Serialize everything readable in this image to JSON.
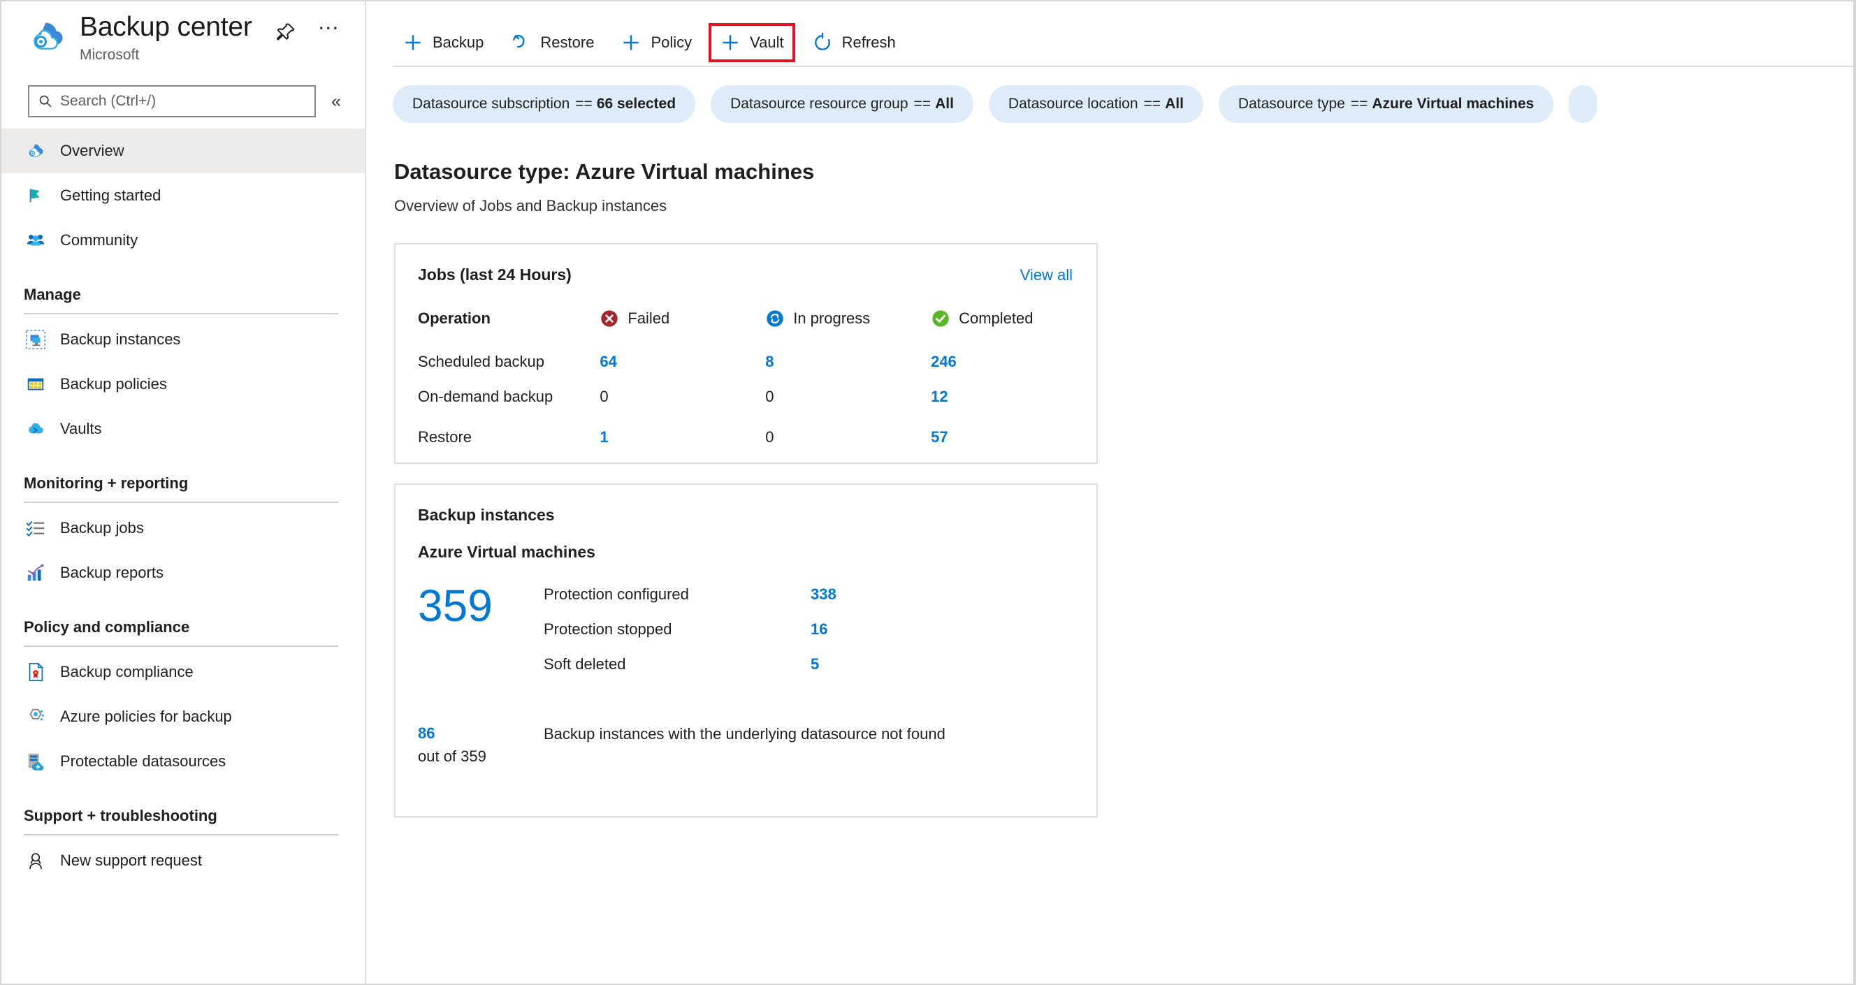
{
  "header": {
    "title": "Backup center",
    "subtitle": "Microsoft",
    "pin_icon": "pin-icon",
    "more_icon": "ellipsis-icon",
    "app_icon": "backup-center-cloud-icon"
  },
  "search": {
    "placeholder": "Search (Ctrl+/)",
    "value": "",
    "icon": "search-icon",
    "collapse_label": "«"
  },
  "sidebar": {
    "top_items": [
      {
        "label": "Overview",
        "icon": "backup-center-cloud-icon",
        "selected": true
      },
      {
        "label": "Getting started",
        "icon": "flag-icon",
        "selected": false
      },
      {
        "label": "Community",
        "icon": "people-icon",
        "selected": false
      }
    ],
    "groups": [
      {
        "title": "Manage",
        "items": [
          {
            "label": "Backup instances",
            "icon": "backup-instances-icon"
          },
          {
            "label": "Backup policies",
            "icon": "backup-policies-grid-icon"
          },
          {
            "label": "Vaults",
            "icon": "vault-cloud-icon"
          }
        ]
      },
      {
        "title": "Monitoring + reporting",
        "items": [
          {
            "label": "Backup jobs",
            "icon": "checklist-icon"
          },
          {
            "label": "Backup reports",
            "icon": "bar-chart-icon"
          }
        ]
      },
      {
        "title": "Policy and compliance",
        "items": [
          {
            "label": "Backup compliance",
            "icon": "compliance-document-icon"
          },
          {
            "label": "Azure policies for backup",
            "icon": "azure-policy-hexagon-icon"
          },
          {
            "label": "Protectable datasources",
            "icon": "protectable-datasource-icon"
          }
        ]
      },
      {
        "title": "Support + troubleshooting",
        "items": [
          {
            "label": "New support request",
            "icon": "support-person-icon"
          }
        ]
      }
    ]
  },
  "toolbar": {
    "commands": [
      {
        "label": "Backup",
        "icon": "plus-icon",
        "highlighted": false
      },
      {
        "label": "Restore",
        "icon": "restore-undo-icon",
        "highlighted": false
      },
      {
        "label": "Policy",
        "icon": "plus-icon",
        "highlighted": false
      },
      {
        "label": "Vault",
        "icon": "plus-icon",
        "highlighted": true
      },
      {
        "label": "Refresh",
        "icon": "refresh-icon",
        "highlighted": false
      }
    ],
    "highlight_color": "#e81123"
  },
  "filters": [
    {
      "field": "Datasource subscription",
      "operator": "==",
      "value": "66 selected"
    },
    {
      "field": "Datasource resource group",
      "operator": "==",
      "value": "All"
    },
    {
      "field": "Datasource location",
      "operator": "==",
      "value": "All"
    },
    {
      "field": "Datasource type",
      "operator": "==",
      "value": "Azure Virtual machines"
    }
  ],
  "page": {
    "title": "Datasource type: Azure Virtual machines",
    "subtitle": "Overview of Jobs and Backup instances"
  },
  "jobs_card": {
    "title": "Jobs (last 24 Hours)",
    "view_all_label": "View all",
    "columns": [
      {
        "label": "Operation",
        "icon": null
      },
      {
        "label": "Failed",
        "icon": "error-circle-icon",
        "color": "#a4262c"
      },
      {
        "label": "In progress",
        "icon": "sync-circle-icon",
        "color": "#0078d4"
      },
      {
        "label": "Completed",
        "icon": "check-circle-icon",
        "color": "#107c10"
      }
    ],
    "rows": [
      {
        "operation": "Scheduled backup",
        "failed": "64",
        "in_progress": "8",
        "completed": "246"
      },
      {
        "operation": "On-demand backup",
        "failed": "0",
        "in_progress": "0",
        "completed": "12"
      },
      {
        "operation": "Restore",
        "failed": "1",
        "in_progress": "0",
        "completed": "57"
      }
    ]
  },
  "instances_card": {
    "title": "Backup instances",
    "subtitle": "Azure Virtual machines",
    "total": "359",
    "stats": [
      {
        "label": "Protection configured",
        "value": "338"
      },
      {
        "label": "Protection stopped",
        "value": "16"
      },
      {
        "label": "Soft deleted",
        "value": "5"
      }
    ],
    "footer": {
      "count": "86",
      "out_of": "out of 359",
      "description": "Backup instances with the underlying datasource not found"
    }
  },
  "colors": {
    "accent": "#0078d4",
    "pill_bg": "#deecf9",
    "selected_bg": "#edebe9",
    "failed": "#a4262c",
    "completed": "#107c10",
    "highlight_box": "#e81123"
  }
}
